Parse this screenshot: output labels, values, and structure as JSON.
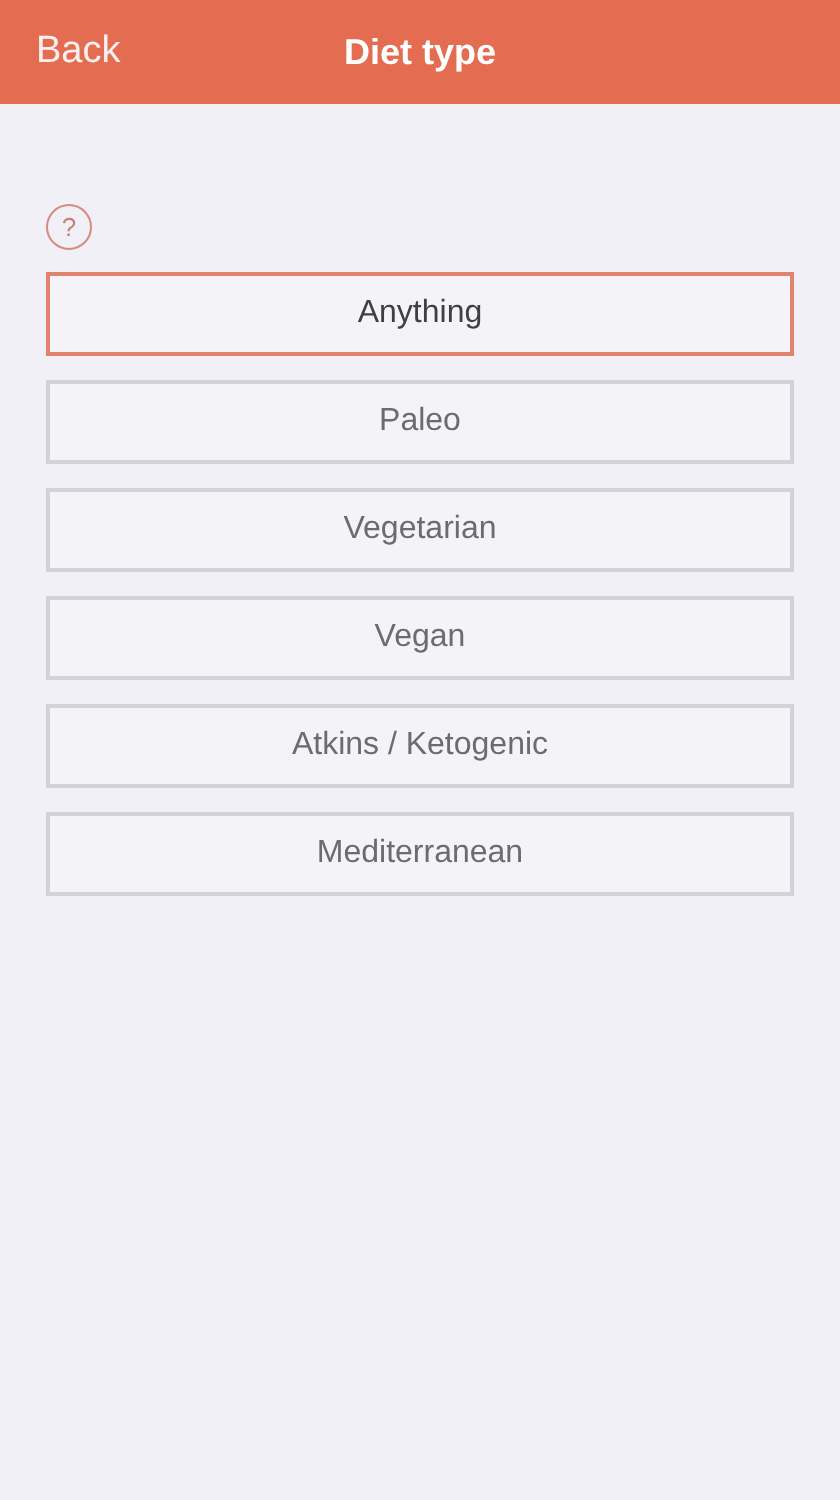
{
  "header": {
    "back": "Back",
    "title": "Diet type"
  },
  "help": {
    "glyph": "?"
  },
  "options": [
    {
      "label": "Anything",
      "selected": true
    },
    {
      "label": "Paleo",
      "selected": false
    },
    {
      "label": "Vegetarian",
      "selected": false
    },
    {
      "label": "Vegan",
      "selected": false
    },
    {
      "label": "Atkins / Ketogenic",
      "selected": false
    },
    {
      "label": "Mediterranean",
      "selected": false
    }
  ]
}
